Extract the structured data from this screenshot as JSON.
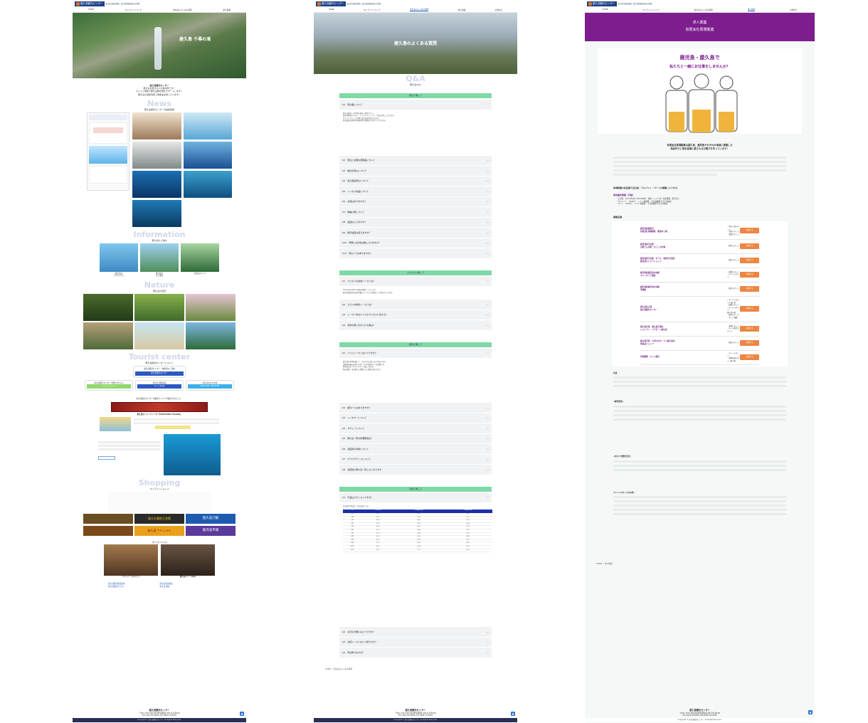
{
  "brand": {
    "logo": "屋久島観光センター",
    "tagline": "屋久島の観光情報、屋久島情報を集まる場所",
    "accent": "#1d3f86",
    "purple": "#7d1d8e",
    "orange": "#ec8642",
    "green": "#7fd9a6"
  },
  "nav": [
    "HOME",
    "オンラインショップ",
    "屋久島のよくある質問",
    "求人情報",
    "お問合せ"
  ],
  "left": {
    "hero_title": "屋久島 千尋の滝",
    "intro": [
      "屋久島観光センター",
      "屋久島を旅する人の案内所です！",
      "ネットと現地で屋久島観光旅をサポートします！",
      "屋久島の最新情報と物産品を扱っています！"
    ],
    "news_title": "News",
    "news_sub": "屋久島観光センターの最新情報",
    "info_title": "Information",
    "info_sub": "屋久島のご案内",
    "info_items": [
      "屋久島の\nモデルプラン",
      "屋久島の\nのご案内",
      "屋久島マップ"
    ],
    "nature_title": "Nature",
    "nature_sub": "屋久島の自然",
    "tourist_title": "Tourist center",
    "tourist_sub": "屋久島観光センターについて",
    "tourist_btn": "屋久島観光センター",
    "tc1": "屋久島観光センター・物産館のご案内",
    "tc2": "屋久島観光センター・物産館",
    "sub_btns": [
      "アクセス・スタッフ",
      "やくしま市場",
      "SANCTUARY YAKUSHIMA"
    ],
    "sub_labels": [
      "屋久島観光センターで働きませんか",
      "屋久島の物産品",
      "屋久島のおすすめ"
    ],
    "award": "屋久島観光センターが優秀ランキング取得されました。",
    "imagesong": "屋久島のイメージソング『SANCTUARY ISLAND』",
    "shopping_title": "Shopping",
    "shopping_sub": "オンラインショップ",
    "shop_labels": [
      "屋久杉美術工芸館",
      "屋久島刀鍛",
      "屋久島 ナチュラル",
      "鹿児島市場"
    ],
    "partner_title": "パートナーシップ",
    "partners": [
      "ライディーブルジェン",
      "屋久島ツアーshop"
    ],
    "links": [
      "屋久島観光施設案内",
      "屋久島宿泊施設",
      "屋久島観光センター",
      "屋久島 物産"
    ],
    "footer_title": "屋久島観光センター",
    "footer_addr": "〒891-4205 鹿児島県熊毛郡屋久島町宮之浦799",
    "footer_tel": "TEL 0997-42-0091 FAX 0997-42-2251",
    "copyright": "Copyright © 屋久島観光センター All Rights Reserved."
  },
  "faq": {
    "hero_title": "屋久島のよくある質問",
    "qa_title": "Q&A",
    "qa_sub": "屋久島Q&A",
    "cat1": "登山に関して",
    "cat1_q": [
      "Q1　登山届について",
      "Q2　登山に必要な装備品について",
      "Q3　縄文杉登山について",
      "Q4　宮之浦岳登山について",
      "Q5　レンタル用品について",
      "Q6　お昼はありますか？",
      "Q7　綺麗小屋について",
      "Q8　電話は入りますか？",
      "Q9　携帯電話は使えますか？",
      "Q10　早朝にお弁当は購入できますか？",
      "Q11　登山バスはありますか？"
    ],
    "cat1_ans": [
      "登山の際は、必ず登山届をご提出下さい。",
      "屋久島観光センター、インフォメーション、登山口等にございます。",
      "サクッとサラッと手軽に登山届を提出できます。",
      "登山届は荒天時や事故の際に捜索の手がかりとなります。"
    ],
    "cat2": "ウミガメに関して",
    "cat2_q": [
      "Q1　ウミガメの産卵シーズンは？",
      "Q2　子ガメの孵化シーズンは？",
      "Q3　シーズン中はいつでもウミガメに会える？",
      "Q4　見学の際に気をつける事は？"
    ],
    "cat2_ans": [
      "5月下旬から8月下旬頃が産卵シーズンです。",
      "屋久島永田浜は日本有数のウミガメ上陸地として知られています。"
    ],
    "cat3": "観光に関して",
    "cat3_q": [
      "Q1　ベストシーズンはいつですか？",
      "Q2　観光バスはありますか？",
      "Q3　レンタカーについて",
      "Q4　タクシーについて",
      "Q5　屋久島一周の所要時間は？",
      "Q6　自転車の利用について",
      "Q7　ヤクスギランドについて",
      "Q8　島乾燥で屋久島一周したいのですが"
    ],
    "cat3_ans": [
      "屋久島は年間を通じて、それぞれに楽しみ方があります。",
      "出発時天候に恵まれれば、3～5月頃がとても快適です。",
      "夏場は海のアクティビティが楽しめます。",
      "秋は紅葉、冬は雪山と季節ごとの魅力があります。"
    ],
    "cat4": "天候に関して",
    "cat4_q": [
      "Q1　気温はどのくらいですか？",
      "Q2　お天気が悪いはいつですか？",
      "Q3　台風シーズンはいつ頃ですか？",
      "Q4　雪は降りますか？"
    ],
    "cat4_ans": "宮之浦平均気温、下記の通りです。",
    "table_head": [
      "月",
      "平均気温",
      "平均最高気温",
      "平均最低気温"
    ],
    "table_rows": [
      [
        "1月",
        "11.5",
        "15.0",
        "8.3"
      ],
      [
        "2月",
        "12.1",
        "15.6",
        "8.7"
      ],
      [
        "3月",
        "14.5",
        "18.0",
        "11.0"
      ],
      [
        "4月",
        "17.8",
        "21.2",
        "14.3"
      ],
      [
        "5月",
        "20.8",
        "24.1",
        "17.6"
      ],
      [
        "6月",
        "23.9",
        "26.8",
        "21.3"
      ],
      [
        "7月",
        "27.3",
        "30.6",
        "24.7"
      ],
      [
        "8月",
        "27.6",
        "31.0",
        "24.9"
      ],
      [
        "9月",
        "25.9",
        "29.2",
        "23.2"
      ],
      [
        "10月",
        "22.3",
        "25.6",
        "19.4"
      ],
      [
        "11月",
        "18.1",
        "21.4",
        "15.0"
      ],
      [
        "12月",
        "13.7",
        "17.1",
        "10.6"
      ]
    ],
    "breadcrumb": "HOME ＞ 屋久島のよくある質問"
  },
  "job": {
    "title1": "求人募集",
    "title2": "有限会社馬場製菓",
    "banner1": "鹿児島・屋久島で",
    "banner2": "私たちと一緒にお仕事をしませんか？",
    "lead": [
      "有限会社馬場製菓は屋久島、鹿児島それぞれの地域に密着した",
      "商品作りに努め皆様に愛されるお菓子を作っています！"
    ],
    "recruit_head": "馬場製菓の各店舗で正社員・アルバイト・パートを募集しています。",
    "salary_head": "採用基本情報（月給）",
    "salary": [
      "・正社員　165,000円〜205,000円　時給（レフト外）社会保険、賞与有り",
      "・アルバイト　970円〜　シフト制勤務　土日祝勤務できる方歓迎",
      "・パート　970円〜　シフト制勤務　土日祝勤務できる方歓迎"
    ],
    "shops_head": "募集店舗",
    "apply": "応募する",
    "jobs": [
      {
        "name": "鹿児島県霧島市\n有限会社馬場製菓・霧島本工場",
        "pos": "・本社工場スタッフ\n・営業スタッフ\n・事務スタッフ"
      },
      {
        "name": "鹿児島県天文館\n白熊どんの館・かごしま市場",
        "pos": "・販売スタッフ"
      },
      {
        "name": "鹿児島県天文館　ホテル・温泉付き宿泊\n鹿児島セレクトショップ",
        "pos": "・販売スタッフ"
      },
      {
        "name": "鹿児島県鹿児島中央駅\nキャッタリア菓処",
        "pos": "・調理スタッフ\n・ホールスタッフ"
      },
      {
        "name": "鹿児島県鹿児島中央駅\n草場館",
        "pos": "・販売スタッフ"
      },
      {
        "name": "屋久島宮之浦\n屋久島観光センター",
        "pos": "レストラン＆カフェ屋久島\n・調理スタッフ\n・ホールスタッフ\n屋久島市場\n・販売スタッフ\n・ネット通販"
      },
      {
        "name": "屋久島空港　屋久島空港内\nレストラン・ユアポート屋久島",
        "pos": "・調理スタッフ\n・ホール販売スタッフ"
      },
      {
        "name": "屋久島空港　24年3月オープン屋久島内\n特産品ショップ",
        "pos": "・販売スタッフ"
      },
      {
        "name": "有明勤務　ネット販売",
        "pos": "・ネットスタッフ\n・事務企画デザイン担当者"
      }
    ],
    "section_contact": "社訓",
    "section_values": "<経営理念>",
    "section_staff": "<あるべき経営方針>",
    "section_credo": "クレド<スタッフの心得>",
    "breadcrumb": "HOME ＞ 求人情報"
  }
}
